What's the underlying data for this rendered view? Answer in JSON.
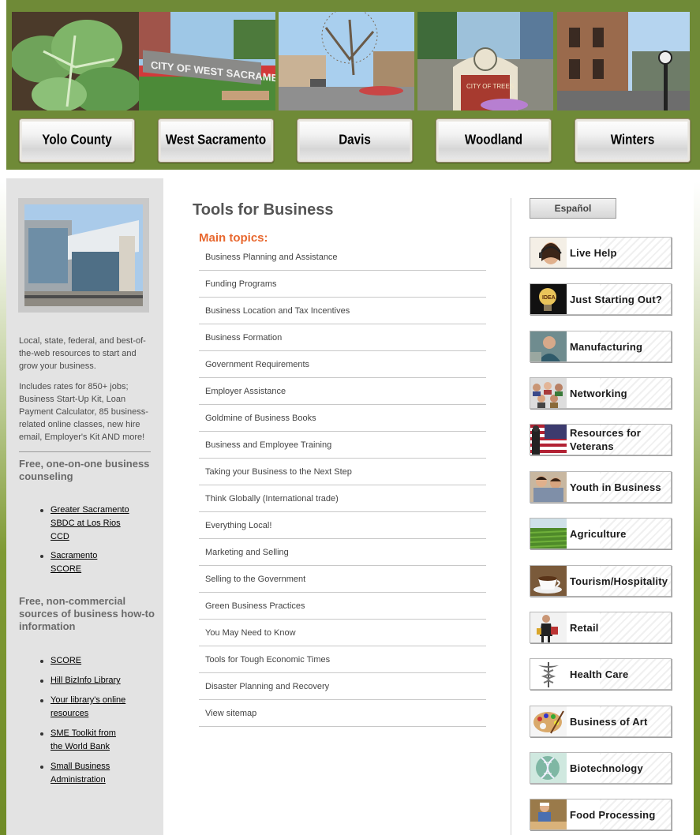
{
  "header": {
    "photos": [
      {
        "name": "cabbage-photo"
      },
      {
        "name": "city-of-west-sacramento-sign-photo",
        "sign_text": "CITY OF WEST SACRAMENTO"
      },
      {
        "name": "davis-street-photo"
      },
      {
        "name": "city-of-trees-sign-photo",
        "sign_text": "CITY OF TREES"
      },
      {
        "name": "winters-main-street-photo"
      }
    ],
    "city_buttons": [
      "Yolo County",
      "West Sacramento",
      "Davis",
      "Woodland",
      "Winters"
    ]
  },
  "left": {
    "intro": "Local, state, federal, and best-of-the-web resources to start and grow your business.",
    "includes": "Includes rates for 850+ jobs; Business Start-Up Kit, Loan Payment Calculator, 85 business-related online classes, new hire email, Employer's Kit AND more!",
    "counseling_heading": "Free, one-on-one business counseling",
    "counseling_links": [
      "Greater Sacramento SBDC at Los Rios CCD",
      "Sacramento SCORE"
    ],
    "howto_heading": "Free, non-commercial sources of business how-to information",
    "howto_links": [
      "SCORE",
      "Hill BizInfo Library",
      "Your library's online resources",
      "SME Toolkit from the World Bank",
      "Small Business Administration"
    ]
  },
  "main": {
    "title": "Tools for Business",
    "topics_label": "Main topics:",
    "topics": [
      "Business Planning and Assistance",
      "Funding Programs",
      "Business Location and Tax Incentives",
      "Business Formation",
      "Government Requirements",
      "Employer Assistance",
      "Goldmine of Business Books",
      "Business and Employee Training",
      "Taking your Business to the Next Step",
      "Think Globally (International trade)",
      "Everything Local!",
      "Marketing and Selling",
      "Selling to the Government",
      "Green Business Practices",
      "You May Need to Know",
      "Tools for Tough Economic Times",
      "Disaster Planning and Recovery",
      "View sitemap"
    ]
  },
  "right": {
    "espanol": "Español",
    "buttons": [
      {
        "label": "Live Help",
        "icon": "headset-agent-icon"
      },
      {
        "label": "Just Starting Out?",
        "icon": "idea-lightbulb-icon"
      },
      {
        "label": "Manufacturing",
        "icon": "factory-worker-icon"
      },
      {
        "label": "Networking",
        "icon": "people-group-icon"
      },
      {
        "label": "Resources for Veterans",
        "icon": "american-flag-icon"
      },
      {
        "label": "Youth in Business",
        "icon": "young-people-icon"
      },
      {
        "label": "Agriculture",
        "icon": "crop-field-icon"
      },
      {
        "label": "Tourism/Hospitality",
        "icon": "coffee-cup-icon"
      },
      {
        "label": "Retail",
        "icon": "shopper-icon"
      },
      {
        "label": "Health Care",
        "icon": "caduceus-icon"
      },
      {
        "label": "Business of Art",
        "icon": "paint-palette-icon"
      },
      {
        "label": "Biotechnology",
        "icon": "dna-icon"
      },
      {
        "label": "Food Processing",
        "icon": "food-worker-icon"
      }
    ]
  },
  "colors": {
    "header_green": "#6f8a37",
    "topics_orange": "#e8682f",
    "sidebar_gray": "#e3e3e3"
  }
}
